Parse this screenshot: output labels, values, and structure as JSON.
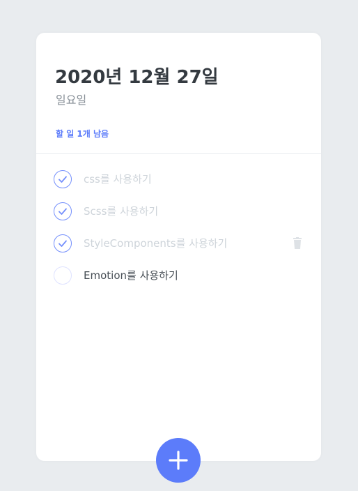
{
  "header": {
    "date": "2020년 12월 27일",
    "day": "일요일",
    "tasks_left": "할 일 1개 남음"
  },
  "todos": [
    {
      "text": "css를 사용하기",
      "done": true
    },
    {
      "text": "Scss를 사용하기",
      "done": true
    },
    {
      "text": "StyleComponents를 사용하기",
      "done": true,
      "show_delete": true
    },
    {
      "text": "Emotion를 사용하기",
      "done": false
    }
  ],
  "icons": {
    "check": "check-icon",
    "delete": "trash-icon",
    "add": "plus-icon"
  },
  "colors": {
    "accent": "#5c7cfa",
    "check": "#748ffc",
    "done_text": "#ced4da",
    "active_text": "#495057",
    "background": "#e9ecef"
  }
}
